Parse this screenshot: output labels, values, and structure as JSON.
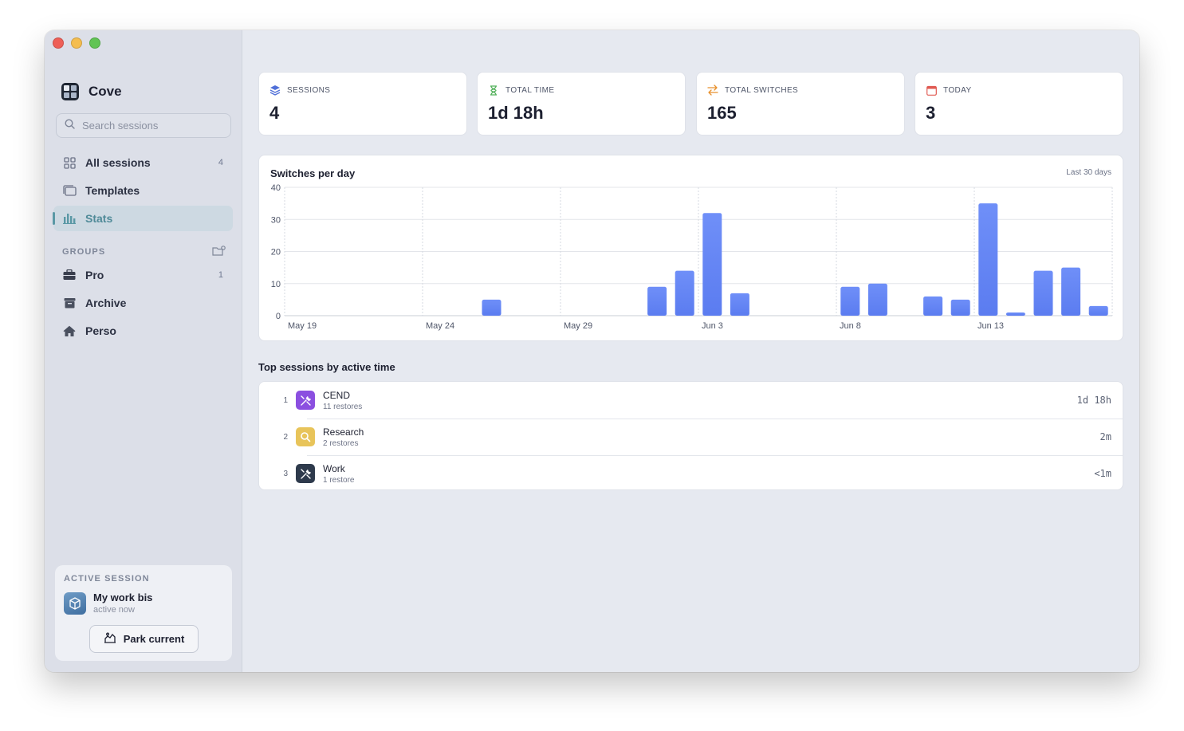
{
  "app": {
    "name": "Cove"
  },
  "search": {
    "placeholder": "Search sessions"
  },
  "nav": [
    {
      "label": "All sessions",
      "count": "4",
      "icon": "grid-icon"
    },
    {
      "label": "Templates",
      "count": "",
      "icon": "templates-icon"
    },
    {
      "label": "Stats",
      "count": "",
      "icon": "bar-chart-icon",
      "active": true
    }
  ],
  "groups": {
    "heading": "GROUPS",
    "items": [
      {
        "label": "Pro",
        "count": "1",
        "icon": "briefcase-icon"
      },
      {
        "label": "Archive",
        "count": "",
        "icon": "archive-box-icon"
      },
      {
        "label": "Perso",
        "count": "",
        "icon": "house-icon"
      }
    ]
  },
  "active_session": {
    "label": "ACTIVE SESSION",
    "name": "My work bis",
    "status": "active now",
    "park_label": "Park current"
  },
  "stats": [
    {
      "label": "SESSIONS",
      "value": "4",
      "icon": "layers-icon",
      "color": "#4f6fd8"
    },
    {
      "label": "TOTAL TIME",
      "value": "1d 18h",
      "icon": "hourglass-icon",
      "color": "#52b05a"
    },
    {
      "label": "TOTAL SWITCHES",
      "value": "165",
      "icon": "switch-arrows-icon",
      "color": "#e8912d"
    },
    {
      "label": "TODAY",
      "value": "3",
      "icon": "calendar-icon",
      "color": "#e05a52"
    }
  ],
  "chart": {
    "title": "Switches per day",
    "range": "Last 30 days"
  },
  "chart_data": {
    "type": "bar",
    "title": "Switches per day",
    "xlabel": "",
    "ylabel": "",
    "ylim": [
      0,
      40
    ],
    "yticks": [
      0,
      10,
      20,
      30,
      40
    ],
    "grid": true,
    "bar_color": "#6f8ff8",
    "x_tick_labels": [
      "May 19",
      "May 24",
      "May 29",
      "Jun 3",
      "Jun 8",
      "Jun 13"
    ],
    "categories": [
      "May 19",
      "May 20",
      "May 21",
      "May 22",
      "May 23",
      "May 24",
      "May 25",
      "May 26",
      "May 27",
      "May 28",
      "May 29",
      "May 30",
      "May 31",
      "Jun 1",
      "Jun 2",
      "Jun 3",
      "Jun 4",
      "Jun 5",
      "Jun 6",
      "Jun 7",
      "Jun 8",
      "Jun 9",
      "Jun 10",
      "Jun 11",
      "Jun 12",
      "Jun 13",
      "Jun 14",
      "Jun 15",
      "Jun 16",
      "Jun 17"
    ],
    "values": [
      0,
      0,
      0,
      0,
      0,
      0,
      0,
      5,
      0,
      0,
      0,
      0,
      0,
      9,
      14,
      32,
      7,
      0,
      0,
      0,
      9,
      10,
      0,
      6,
      5,
      35,
      1,
      14,
      15,
      3
    ]
  },
  "top_sessions": {
    "title": "Top sessions by active time",
    "items": [
      {
        "rank": "1",
        "name": "CEND",
        "sub": "11 restores",
        "time": "1d 18h",
        "icon": "tools-icon",
        "color": "#8b4fe0"
      },
      {
        "rank": "2",
        "name": "Research",
        "sub": "2 restores",
        "time": "2m",
        "icon": "magnifier-icon",
        "color": "#e8c45a"
      },
      {
        "rank": "3",
        "name": "Work",
        "sub": "1 restore",
        "time": "<1m",
        "icon": "tools-icon",
        "color": "#2e3a4c"
      }
    ]
  }
}
